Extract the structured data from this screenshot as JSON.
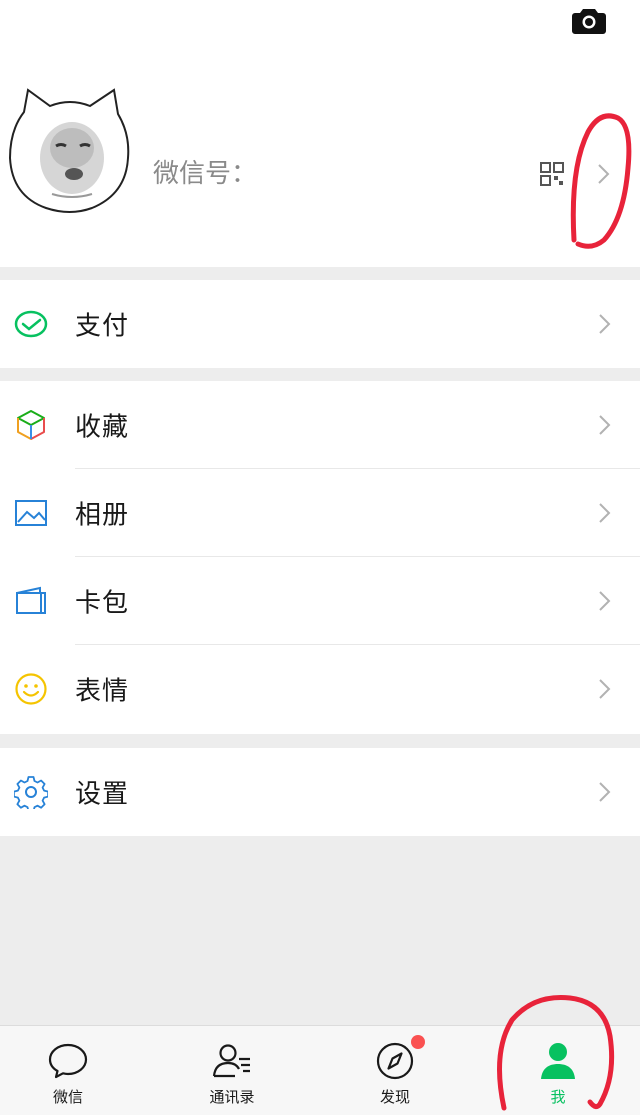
{
  "profile": {
    "wechat_id_label": "微信号：",
    "wechat_id_value": "",
    "icons": {
      "camera": "camera-icon",
      "qr": "qr-code-icon",
      "chevron": "chevron-right-icon"
    }
  },
  "menu": {
    "pay": {
      "label": "支付",
      "icon": "pay-icon"
    },
    "favorites": {
      "label": "收藏",
      "icon": "cube-icon"
    },
    "album": {
      "label": "相册",
      "icon": "picture-icon"
    },
    "cards": {
      "label": "卡包",
      "icon": "wallet-icon"
    },
    "stickers": {
      "label": "表情",
      "icon": "smile-icon"
    },
    "settings": {
      "label": "设置",
      "icon": "gear-icon"
    }
  },
  "tabs": [
    {
      "label": "微信",
      "icon": "chat-bubble-icon",
      "active": false
    },
    {
      "label": "通讯录",
      "icon": "contacts-icon",
      "active": false
    },
    {
      "label": "发现",
      "icon": "compass-icon",
      "active": false,
      "badge": true
    },
    {
      "label": "我",
      "icon": "person-icon",
      "active": true
    }
  ],
  "colors": {
    "accent_green": "#07c160",
    "badge_red": "#fa5151",
    "annotation_red": "#e8233a",
    "background": "#ededed"
  }
}
